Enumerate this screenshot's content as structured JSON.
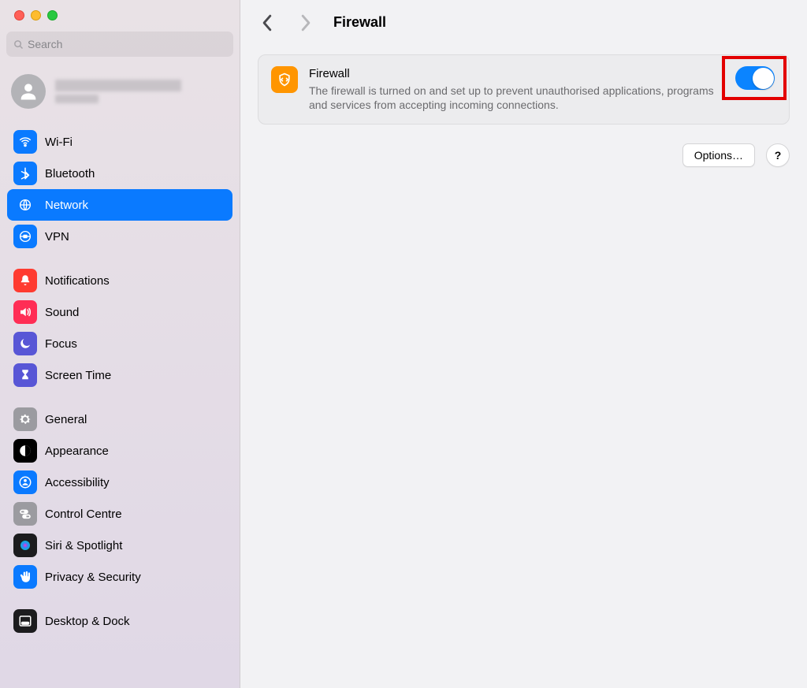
{
  "window": {
    "title": "Firewall"
  },
  "search": {
    "placeholder": "Search"
  },
  "sidebar": {
    "groups": [
      {
        "items": [
          {
            "label": "Wi-Fi",
            "icon": "wifi",
            "iconBg": "#0a7aff",
            "fg": "#fff"
          },
          {
            "label": "Bluetooth",
            "icon": "bluetooth",
            "iconBg": "#0a7aff",
            "fg": "#fff"
          },
          {
            "label": "Network",
            "icon": "globe",
            "iconBg": "#0a7aff",
            "fg": "#fff",
            "active": true
          },
          {
            "label": "VPN",
            "icon": "vpn",
            "iconBg": "#0a7aff",
            "fg": "#fff"
          }
        ]
      },
      {
        "items": [
          {
            "label": "Notifications",
            "icon": "bell",
            "iconBg": "#ff3b30",
            "fg": "#fff"
          },
          {
            "label": "Sound",
            "icon": "sound",
            "iconBg": "#ff2d55",
            "fg": "#fff"
          },
          {
            "label": "Focus",
            "icon": "moon",
            "iconBg": "#5856d6",
            "fg": "#fff"
          },
          {
            "label": "Screen Time",
            "icon": "hourglass",
            "iconBg": "#5856d6",
            "fg": "#fff"
          }
        ]
      },
      {
        "items": [
          {
            "label": "General",
            "icon": "gear",
            "iconBg": "#9b9ba0",
            "fg": "#fff"
          },
          {
            "label": "Appearance",
            "icon": "contrast",
            "iconBg": "#000000",
            "fg": "#fff"
          },
          {
            "label": "Accessibility",
            "icon": "person",
            "iconBg": "#0a7aff",
            "fg": "#fff"
          },
          {
            "label": "Control Centre",
            "icon": "switches",
            "iconBg": "#9b9ba0",
            "fg": "#fff"
          },
          {
            "label": "Siri & Spotlight",
            "icon": "siri",
            "iconBg": "#1c1c1e",
            "fg": "#fff"
          },
          {
            "label": "Privacy & Security",
            "icon": "hand",
            "iconBg": "#0a7aff",
            "fg": "#fff"
          }
        ]
      },
      {
        "items": [
          {
            "label": "Desktop & Dock",
            "icon": "dock",
            "iconBg": "#1c1c1e",
            "fg": "#fff"
          }
        ]
      }
    ]
  },
  "firewall": {
    "title": "Firewall",
    "description": "The firewall is turned on and set up to prevent unauthorised applications, programs and services from accepting incoming connections.",
    "iconBg": "#ff9500",
    "enabled": true
  },
  "actions": {
    "options": "Options…",
    "help": "?"
  }
}
